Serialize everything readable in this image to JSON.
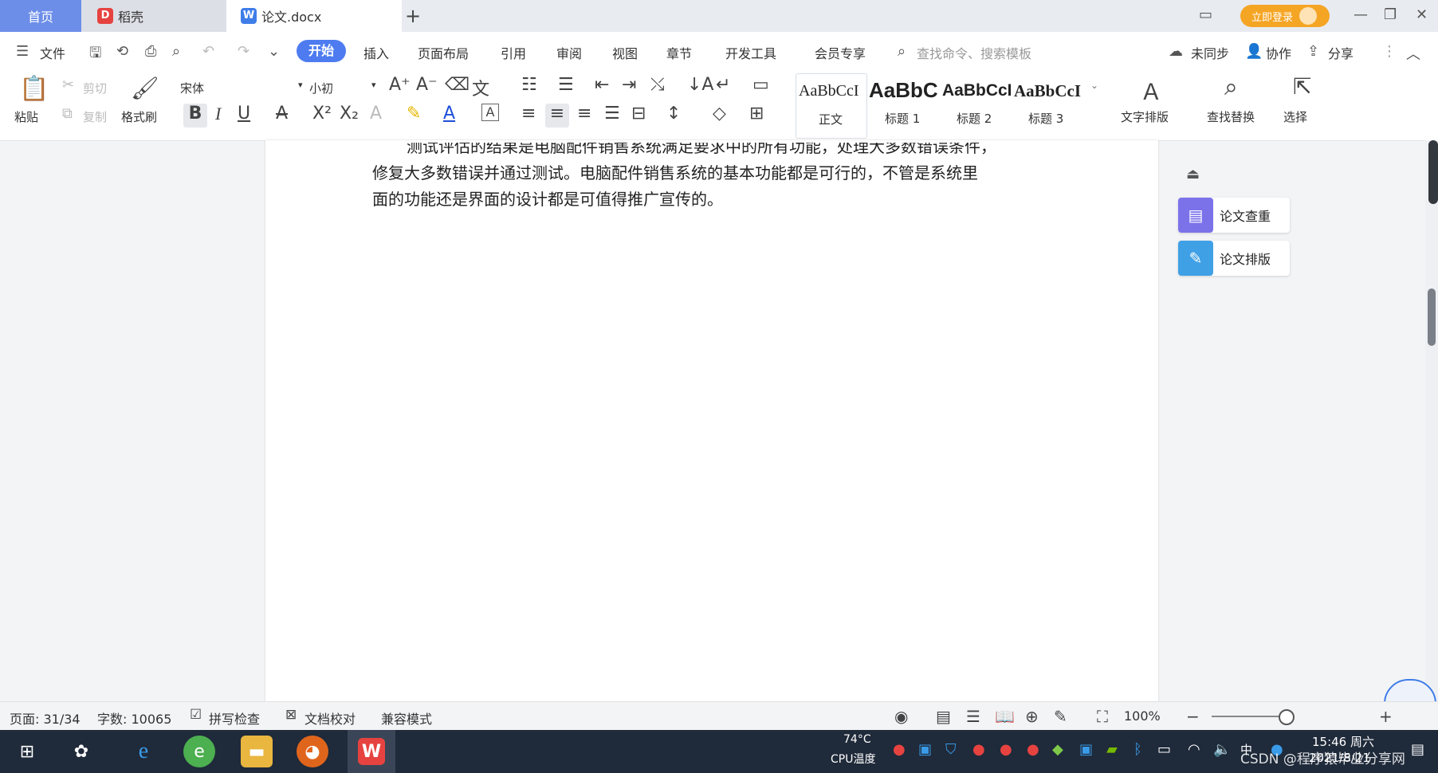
{
  "tabs": {
    "home": "首页",
    "daoke": "稻壳",
    "doc": "论文.docx",
    "new_tab": "+"
  },
  "titlebar": {
    "login": "立即登录"
  },
  "menu": {
    "file": "文件",
    "start": "开始",
    "insert": "插入",
    "layout": "页面布局",
    "reference": "引用",
    "review": "审阅",
    "view": "视图",
    "chapter": "章节",
    "devtools": "开发工具",
    "member": "会员专享",
    "search_cmd": "查找命令、搜索模板",
    "unsynced": "未同步",
    "collab": "协作",
    "share": "分享"
  },
  "ribbon": {
    "paste": "粘贴",
    "cut": "剪切",
    "copy": "复制",
    "format_painter": "格式刷",
    "font_name": "宋体",
    "font_size": "小初",
    "styles": [
      {
        "sample": "AaBbCcI",
        "label": "正文"
      },
      {
        "sample": "AaBbC",
        "label": "标题 1"
      },
      {
        "sample": "AaBbCcI",
        "label": "标题 2"
      },
      {
        "sample": "AaBbCcI",
        "label": "标题 3"
      }
    ],
    "text_layout": "文字排版",
    "find_replace": "查找替换",
    "select": "选择"
  },
  "document": {
    "line1": "测试评估的结果是电脑配件销售系统满足要求中的所有功能，处理大多数错误条件，",
    "line2": "修复大多数错误并通过测试。电脑配件销售系统的基本功能都是可行的，不管是系统里",
    "line3": "面的功能还是界面的设计都是可值得推广宣传的。"
  },
  "side_panel": {
    "check": "论文查重",
    "format": "论文排版"
  },
  "status": {
    "page": "页面: 31/34",
    "words": "字数: 10065",
    "spell": "拼写检查",
    "proof": "文档校对",
    "compat": "兼容模式",
    "zoom": "100%"
  },
  "taskbar": {
    "temp": "74°C",
    "cpu": "CPU温度",
    "time": "15:46 周六",
    "date": "2021/8/21",
    "watermark": "CSDN @程序猿毕业分享网"
  },
  "colors": {
    "accent": "#4e7cf0",
    "tab_home": "#6d8ee8",
    "login_btn": "#f5a524"
  }
}
